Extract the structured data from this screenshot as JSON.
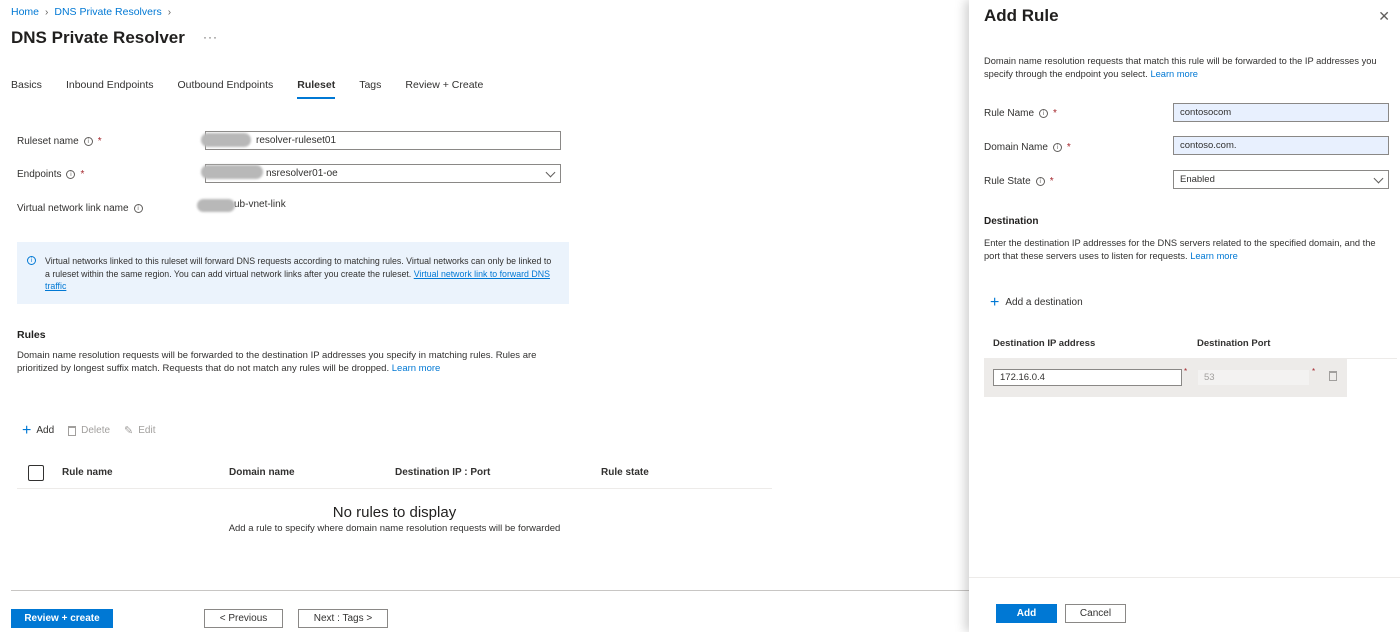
{
  "breadcrumb": {
    "items": [
      "Home",
      "DNS Private Resolvers"
    ]
  },
  "page": {
    "title": "DNS Private Resolver",
    "more": "···"
  },
  "tabs": [
    "Basics",
    "Inbound Endpoints",
    "Outbound Endpoints",
    "Ruleset",
    "Tags",
    "Review + Create"
  ],
  "active_tab": "Ruleset",
  "form": {
    "ruleset_name_label": "Ruleset name",
    "ruleset_name_value": "resolver-ruleset01",
    "endpoints_label": "Endpoints",
    "endpoints_value": "nsresolver01-oe",
    "vnet_link_label": "Virtual network link name",
    "vnet_link_value": "ub-vnet-link",
    "required_mark": "*",
    "info_glyph": "i"
  },
  "infobox": {
    "text": "Virtual networks linked to this ruleset will forward DNS requests according to matching rules. Virtual networks can only be linked to a ruleset within the same region. You can add virtual network links after you create the ruleset.",
    "link": "Virtual network link to forward DNS traffic"
  },
  "rules": {
    "heading": "Rules",
    "description": "Domain name resolution requests will be forwarded to the destination IP addresses you specify in matching rules. Rules are prioritized by longest suffix match. Requests that do not match any rules will be dropped.",
    "learn_more": "Learn more",
    "toolbar": {
      "add": "Add",
      "delete": "Delete",
      "edit": "Edit"
    },
    "columns": [
      "Rule name",
      "Domain name",
      "Destination IP : Port",
      "Rule state"
    ],
    "empty_title": "No rules to display",
    "empty_subtitle": "Add a rule to specify where domain name resolution requests will be forwarded"
  },
  "footer": {
    "review_create": "Review + create",
    "previous": "< Previous",
    "next": "Next : Tags >"
  },
  "panel": {
    "title": "Add Rule",
    "close": "✕",
    "intro": "Domain name resolution requests that match this rule will be forwarded to the IP addresses you specify through the endpoint you select.",
    "learn_more": "Learn more",
    "rule_name_label": "Rule Name",
    "rule_name_value": "contosocom",
    "domain_name_label": "Domain Name",
    "domain_name_value": "contoso.com.",
    "rule_state_label": "Rule State",
    "rule_state_value": "Enabled",
    "destination_heading": "Destination",
    "destination_desc": "Enter the destination IP addresses for the DNS servers related to the specified domain, and the port that these servers uses to listen for requests.",
    "add_destination": "Add a destination",
    "col_ip": "Destination IP address",
    "col_port": "Destination Port",
    "dest_ip_value": "172.16.0.4",
    "dest_port_value": "53",
    "add_button": "Add",
    "cancel_button": "Cancel"
  },
  "colors": {
    "accent": "#0078d4",
    "info_bg": "#ebf3fc",
    "required": "#a4262c"
  }
}
